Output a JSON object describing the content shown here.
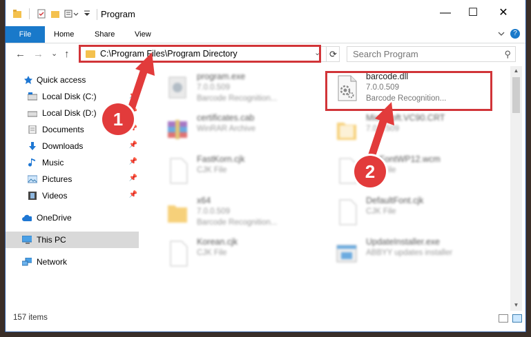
{
  "window": {
    "title": "Program",
    "controls": [
      "—",
      "☐",
      "✕"
    ]
  },
  "ribbon": {
    "tabs": [
      {
        "label": "File"
      },
      {
        "label": "Home"
      },
      {
        "label": "Share"
      },
      {
        "label": "View"
      }
    ],
    "expand_icon": "chevron-down-icon",
    "help_label": "?"
  },
  "nav": {
    "back": "←",
    "forward": "→",
    "recent": "⌄",
    "up": "↑"
  },
  "address": {
    "path": "C:\\Program Files\\Program Directory",
    "refresh": "⟳",
    "dropdown": "⌄"
  },
  "search": {
    "placeholder": "Search Program",
    "icon": "⚲"
  },
  "sidebar": {
    "items": [
      {
        "label": "Quick access",
        "pin": ""
      },
      {
        "label": "Local Disk (C:)",
        "pin": "📌"
      },
      {
        "label": "Local Disk (D:)",
        "pin": "📌"
      },
      {
        "label": "Documents",
        "pin": "📌"
      },
      {
        "label": "Downloads",
        "pin": "📌"
      },
      {
        "label": "Music",
        "pin": "📌"
      },
      {
        "label": "Pictures",
        "pin": "📌"
      },
      {
        "label": "Videos",
        "pin": "📌"
      },
      {
        "label": "OneDrive",
        "pin": ""
      },
      {
        "label": "This PC",
        "pin": ""
      },
      {
        "label": "Network",
        "pin": ""
      }
    ]
  },
  "files": [
    {
      "name": "program.exe",
      "line1": "7.0.0.509",
      "line2": "Barcode Recognition...",
      "blurred": true
    },
    {
      "name": "barcode.dll",
      "line1": "7.0.0.509",
      "line2": "Barcode Recognition...",
      "blurred": false
    },
    {
      "name": "certificates.cab",
      "line1": "WinRAR Archive",
      "line2": "",
      "blurred": true
    },
    {
      "name": "Microsoft.VC90.CRT",
      "line1": "7.0.0.509",
      "line2": "",
      "blurred": true
    },
    {
      "name": "FastKorn.cjk",
      "line1": "CJK File",
      "line2": "",
      "blurred": true
    },
    {
      "name": "BarFontWP12.wcm",
      "line1": "CJK File",
      "line2": "",
      "blurred": true
    },
    {
      "name": "x64",
      "line1": "7.0.0.509",
      "line2": "Barcode Recognition...",
      "blurred": true
    },
    {
      "name": "DefaultFont.cjk",
      "line1": "CJK File",
      "line2": "",
      "blurred": true
    },
    {
      "name": "Korean.cjk",
      "line1": "CJK File",
      "line2": "",
      "blurred": true
    },
    {
      "name": "UpdateInstaller.exe",
      "line1": "ABBYY updates installer",
      "line2": "",
      "blurred": true
    }
  ],
  "status": {
    "count": "157 items"
  },
  "callouts": [
    {
      "number": "1"
    },
    {
      "number": "2"
    }
  ],
  "colors": {
    "accent": "#1979ca",
    "highlight": "#d13438",
    "callout": "#e23b3b",
    "folder": "#f4c14e"
  }
}
